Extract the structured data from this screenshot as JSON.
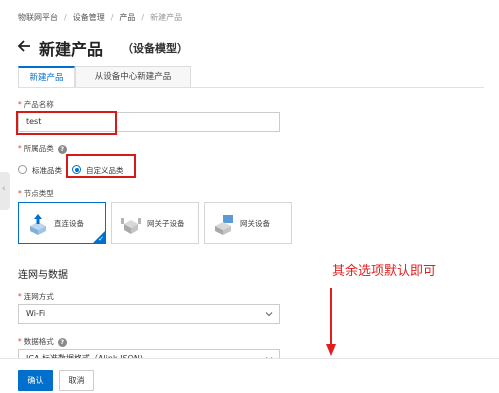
{
  "breadcrumb": [
    "物联网平台",
    "设备管理",
    "产品",
    "新建产品"
  ],
  "page": {
    "title": "新建产品",
    "subtitle": "（设备模型）"
  },
  "tabs": [
    {
      "label": "新建产品",
      "active": true
    },
    {
      "label": "从设备中心新建产品",
      "active": false
    }
  ],
  "form": {
    "product_name": {
      "label": "产品名称",
      "value": "test"
    },
    "category": {
      "label": "所属品类",
      "options": [
        {
          "label": "标准品类",
          "selected": false
        },
        {
          "label": "自定义品类",
          "selected": true
        }
      ]
    },
    "node_type": {
      "label": "节点类型",
      "options": [
        {
          "label": "直连设备",
          "selected": true
        },
        {
          "label": "网关子设备",
          "selected": false
        },
        {
          "label": "网关设备",
          "selected": false
        }
      ]
    },
    "network_section": "连网与数据",
    "network_mode": {
      "label": "连网方式",
      "value": "Wi-Fi"
    },
    "data_format": {
      "label": "数据格式",
      "value": "ICA 标准数据格式（Alink JSON)"
    }
  },
  "annotation": {
    "text": "其余选项默认即可",
    "color": "#e01e1e"
  },
  "footer": {
    "confirm": "确认",
    "cancel": "取消"
  },
  "colors": {
    "accent": "#0070cc",
    "highlight": "#d51a1a"
  },
  "help_glyph": "?",
  "handle_glyph": "‹",
  "check_glyph": "✓"
}
